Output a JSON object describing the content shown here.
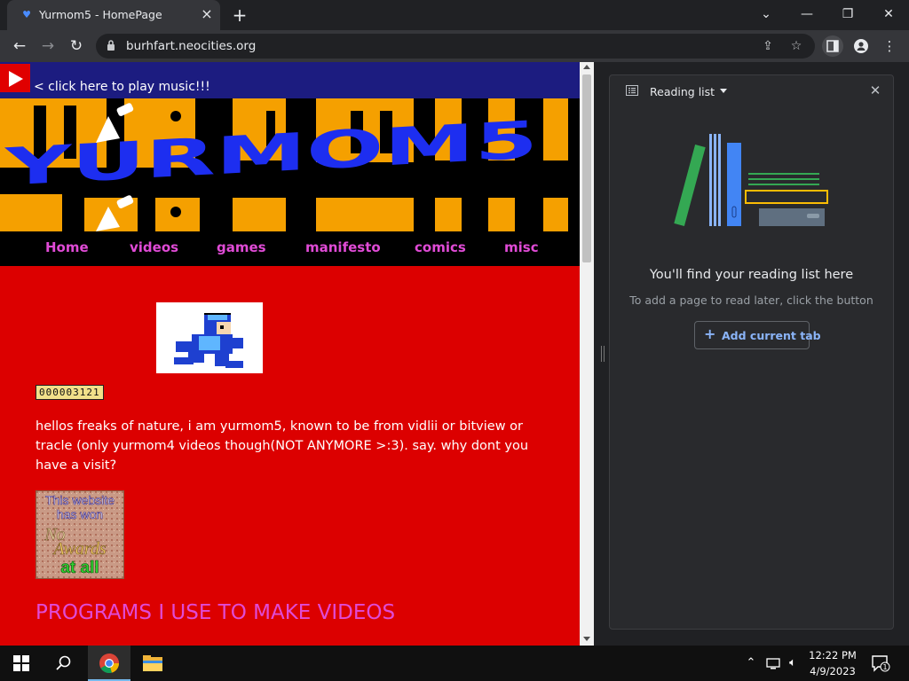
{
  "browser": {
    "tab_title": "Yurmom5 - HomePage",
    "url": "burhfart.neocities.org"
  },
  "page": {
    "music_link": "< click here to play music!!!",
    "banner_text": "YURMOM5",
    "nav_items": [
      "Home",
      "videos",
      "games",
      "manifesto",
      "comics",
      "misc"
    ],
    "hit_counter": "000003121",
    "intro": "hellos freaks of nature, i am yurmom5, known to be from vidlii or bitview or tracle (only yurmom4 videos though(NOT ANYMORE >:3). say. why dont you have a visit?",
    "award_badge": {
      "line1": "This website",
      "line2": "has won",
      "line3": "No",
      "line4": "Awards",
      "line5": "at all"
    },
    "section_heading": "PROGRAMS I USE TO MAKE VIDEOS"
  },
  "reading_list": {
    "title": "Reading list",
    "empty_heading": "You'll find your reading list here",
    "empty_subtext": "To add a page to read later, click the button",
    "add_button": "Add current tab"
  },
  "taskbar": {
    "time": "12:22 PM",
    "date": "4/9/2023",
    "notification_count": "1"
  },
  "colors": {
    "page_background": "#dc0000",
    "nav_link": "#e04bd6",
    "banner_orange": "#f5a000",
    "banner_blue": "#1d2ef0",
    "accent_blue": "#8ab4f8"
  },
  "icons": [
    "back-arrow-icon",
    "forward-arrow-icon",
    "reload-icon",
    "lock-icon",
    "share-icon",
    "star-icon",
    "side-panel-icon",
    "profile-icon",
    "kebab-menu-icon",
    "play-icon",
    "list-icon",
    "dropdown-icon",
    "close-icon",
    "plus-icon",
    "windows-start-icon",
    "search-icon",
    "chrome-icon",
    "file-explorer-icon",
    "chevron-up-icon",
    "network-icon",
    "volume-icon",
    "notification-icon"
  ]
}
